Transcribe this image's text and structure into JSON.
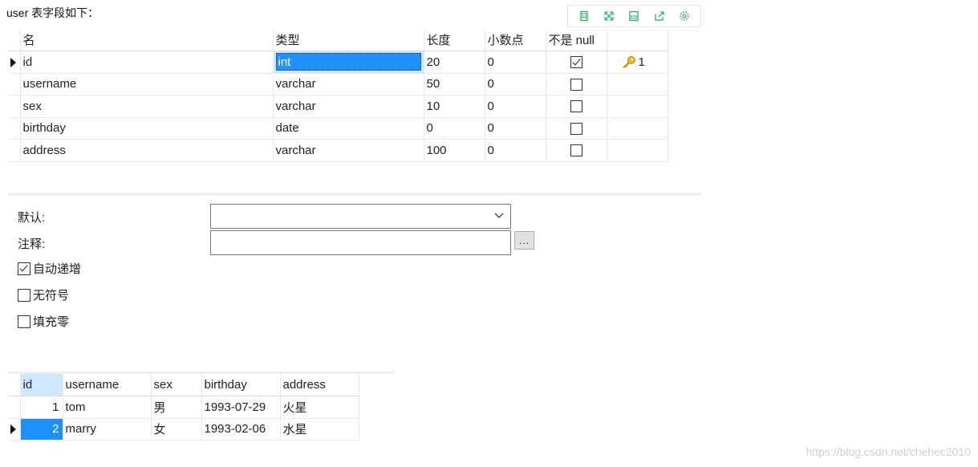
{
  "caption": "user 表字段如下：",
  "toolbar": {
    "icons": [
      "copy-icon",
      "expand-icon",
      "save-icon",
      "share-icon",
      "settings-icon"
    ],
    "accent": "#27ae60"
  },
  "design": {
    "headers": [
      "名",
      "类型",
      "长度",
      "小数点",
      "不是 null",
      ""
    ],
    "rows": [
      {
        "name": "id",
        "type": "int",
        "length": "20",
        "decimals": "0",
        "not_null": true,
        "key": "1"
      },
      {
        "name": "username",
        "type": "varchar",
        "length": "50",
        "decimals": "0",
        "not_null": false,
        "key": ""
      },
      {
        "name": "sex",
        "type": "varchar",
        "length": "10",
        "decimals": "0",
        "not_null": false,
        "key": ""
      },
      {
        "name": "birthday",
        "type": "date",
        "length": "0",
        "decimals": "0",
        "not_null": false,
        "key": ""
      },
      {
        "name": "address",
        "type": "varchar",
        "length": "100",
        "decimals": "0",
        "not_null": false,
        "key": ""
      }
    ]
  },
  "props": {
    "default_label": "默认:",
    "comment_label": "注释:",
    "default_value": "",
    "comment_value": "",
    "dots_label": "...",
    "auto_increment_label": "自动递增",
    "unsigned_label": "无符号",
    "zerofill_label": "填充零",
    "auto_increment": true,
    "unsigned": false,
    "zerofill": false
  },
  "data": {
    "headers": [
      "id",
      "username",
      "sex",
      "birthday",
      "address"
    ],
    "rows": [
      {
        "id": "1",
        "username": "tom",
        "sex": "男",
        "birthday": "1993-07-29",
        "address": "火星"
      },
      {
        "id": "2",
        "username": "marry",
        "sex": "女",
        "birthday": "1993-02-06",
        "address": "水星"
      }
    ]
  },
  "watermark": "https://blog.csdn.net/chehec2010"
}
